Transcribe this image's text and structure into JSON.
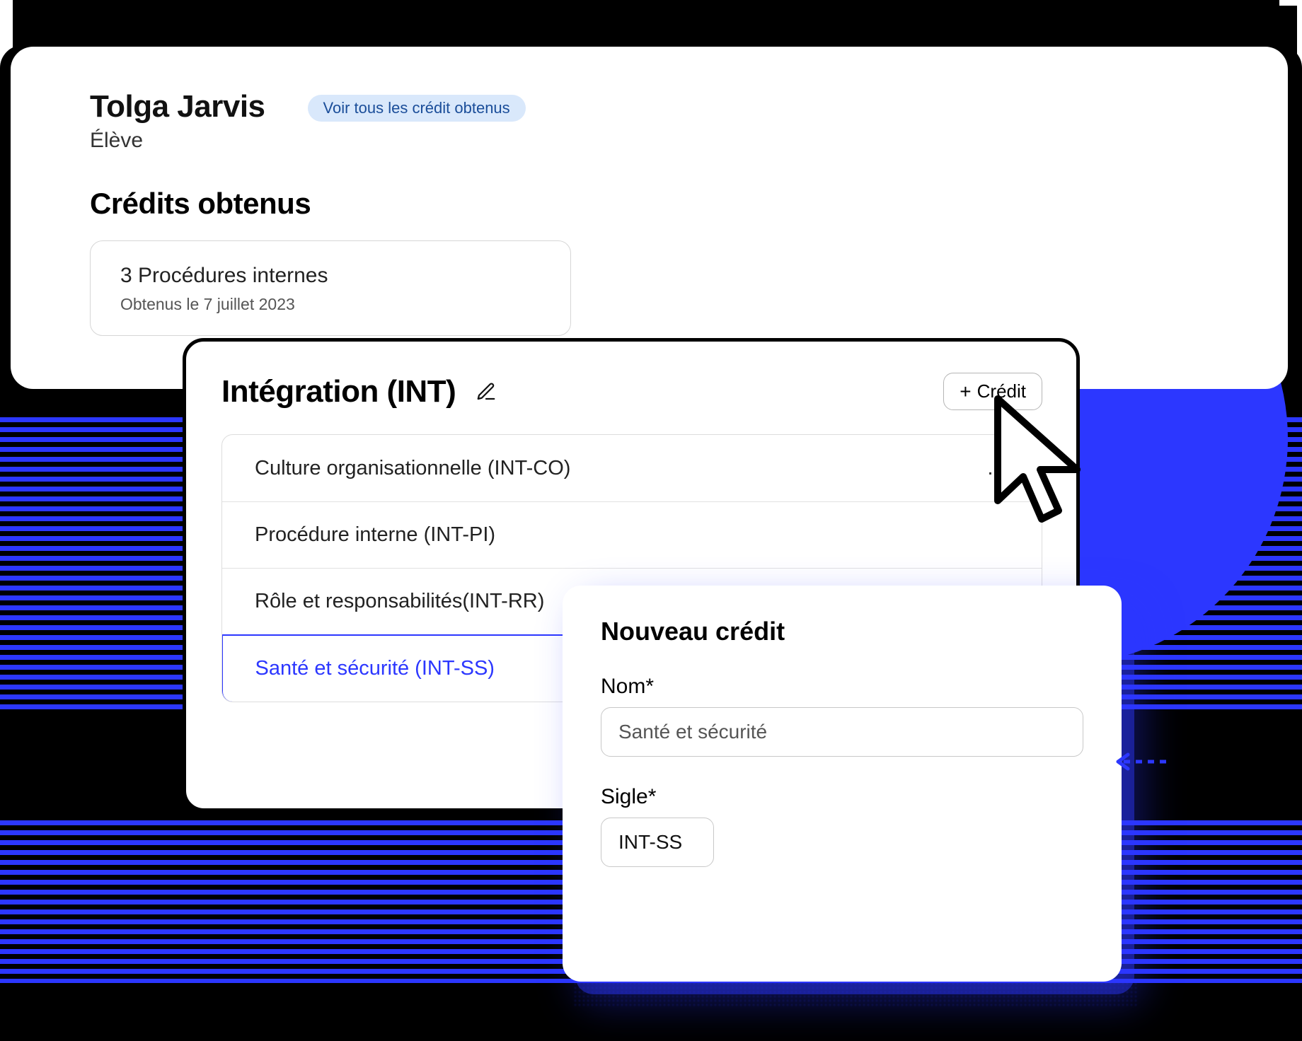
{
  "profile": {
    "name": "Tolga Jarvis",
    "role": "Élève",
    "view_all_pill": "Voir tous les crédit obtenus",
    "credits_title": "Crédits obtenus",
    "summary": {
      "title": "3 Procédures internes",
      "subtitle": "Obtenus le 7 juillet 2023"
    }
  },
  "integration": {
    "title": "Intégration (INT)",
    "add_credit_label": "Crédit",
    "rows": [
      {
        "label": "Culture organisationnelle (INT-CO)"
      },
      {
        "label": "Procédure interne (INT-PI)"
      },
      {
        "label": "Rôle et responsabilités(INT-RR)"
      },
      {
        "label": "Santé et sécurité (INT-SS)"
      }
    ]
  },
  "new_credit": {
    "title": "Nouveau crédit",
    "name_label": "Nom*",
    "name_value": "Santé et sécurité",
    "code_label": "Sigle*",
    "code_value": "INT-SS"
  },
  "icons": {
    "pencil": "pencil-icon",
    "plus": "plus-icon",
    "more": "more-icon",
    "cursor": "cursor-icon"
  }
}
